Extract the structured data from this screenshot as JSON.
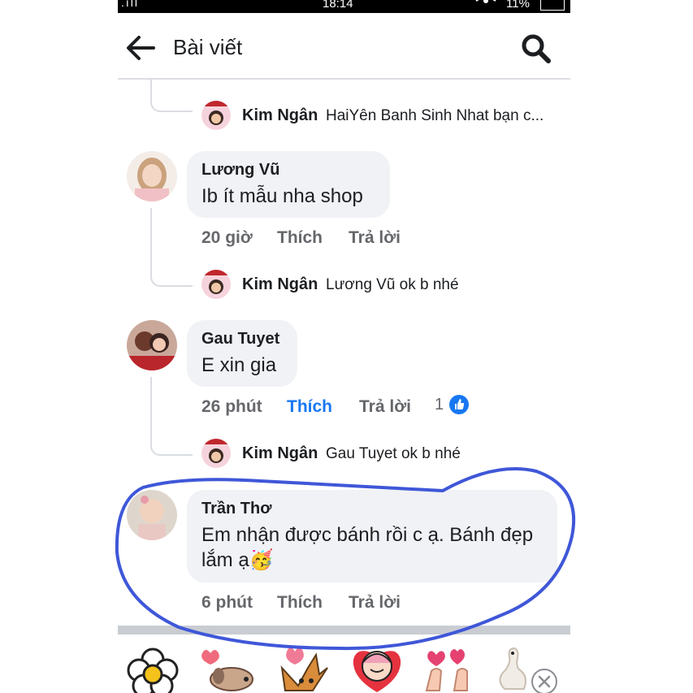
{
  "status_bar": {
    "time": "18:14",
    "battery": "11%",
    "signal": ".ıll",
    "eye_icon": "eye-icon"
  },
  "header": {
    "title": "Bài viết",
    "back_icon": "arrow-left-icon",
    "search_icon": "search-icon"
  },
  "comments": [
    {
      "reply": {
        "author": "Kim Ngân",
        "text": "HaiYên Banh Sinh Nhat bạn c..."
      }
    },
    {
      "author": "Lương Vũ",
      "text": "Ib ít mẫu nha shop",
      "time": "20 giờ",
      "like_label": "Thích",
      "reply_label": "Trả lời",
      "reply": {
        "author": "Kim Ngân",
        "text": "Lương Vũ ok b nhé"
      }
    },
    {
      "author": "Gau Tuyet",
      "text": "E xin gia",
      "time": "26 phút",
      "like_label": "Thích",
      "reply_label": "Trả lời",
      "like_count": "1",
      "liked": true,
      "reply": {
        "author": "Kim Ngân",
        "text": "Gau Tuyet ok b nhé"
      }
    },
    {
      "author": "Trần Thơ",
      "text_line1": "Em nhận được bánh rồi c ạ. Bánh đẹp",
      "text_line2": "lắm ạ",
      "emoji": "🥳",
      "time": "6 phút",
      "like_label": "Thích",
      "reply_label": "Trả lời"
    }
  ],
  "sticker_tray": {
    "stickers": [
      "flower-sticker",
      "dog-heart-sticker",
      "fox-sticker",
      "girl-heart-sticker",
      "finger-heart-sticker",
      "finger-heart-sticker-2",
      "swan-sticker"
    ],
    "close_icon": "close-icon"
  },
  "colors": {
    "accent": "#1877f2",
    "annotation": "#3f57d8",
    "bubble": "#f0f2f5",
    "meta": "#65676b"
  }
}
